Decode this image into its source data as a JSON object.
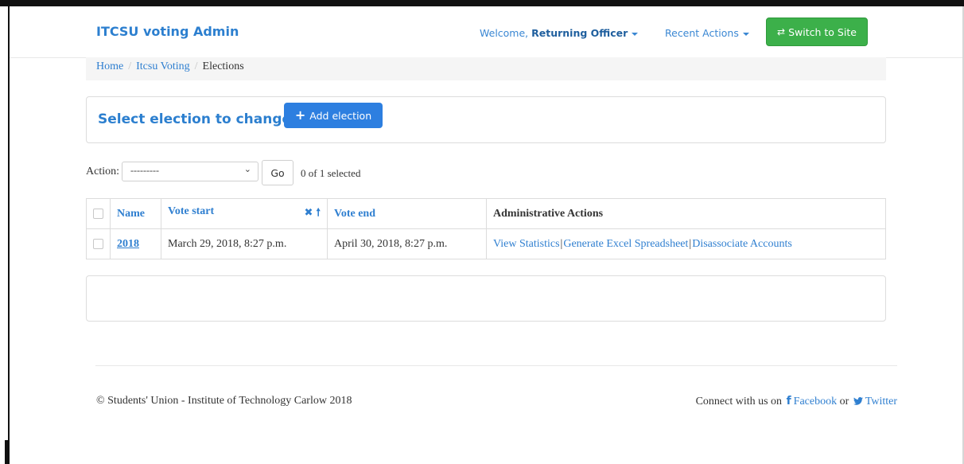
{
  "navbar": {
    "brand": "ITCSU voting Admin",
    "welcome_prefix": "Welcome,",
    "user_name": "Returning Officer",
    "recent_actions": "Recent Actions",
    "switch_button": "Switch to Site",
    "switch_icon": "exchange-icon",
    "switch_color": "#3cb04a"
  },
  "breadcrumb": {
    "items": [
      "Home",
      "Itcsu Voting"
    ],
    "current": "Elections",
    "separator": "/"
  },
  "header": {
    "title": "Select election to change",
    "add_button": "Add election",
    "add_icon": "plus-icon",
    "accent_color": "#2d7fe0"
  },
  "actions": {
    "label": "Action:",
    "selected_value": "---------",
    "go_button": "Go",
    "selection_status": "0 of 1 selected"
  },
  "table": {
    "columns": [
      "Name",
      "Vote start",
      "Vote end",
      "Administrative Actions"
    ],
    "sort_icons": [
      "remove-icon",
      "arrow-up-icon"
    ],
    "rows": [
      {
        "name": "2018",
        "vote_start": "March 29, 2018, 8:27 p.m.",
        "vote_end": "April 30, 2018, 8:27 p.m.",
        "admin_actions": [
          "View Statistics",
          "Generate Excel Spreadsheet",
          "Disassociate Accounts"
        ]
      }
    ]
  },
  "footer": {
    "copyright": "© Students' Union - Institute of Technology Carlow 2018",
    "connect_prefix": "Connect with us on",
    "facebook": "Facebook",
    "or_text": "or",
    "twitter": "Twitter"
  }
}
